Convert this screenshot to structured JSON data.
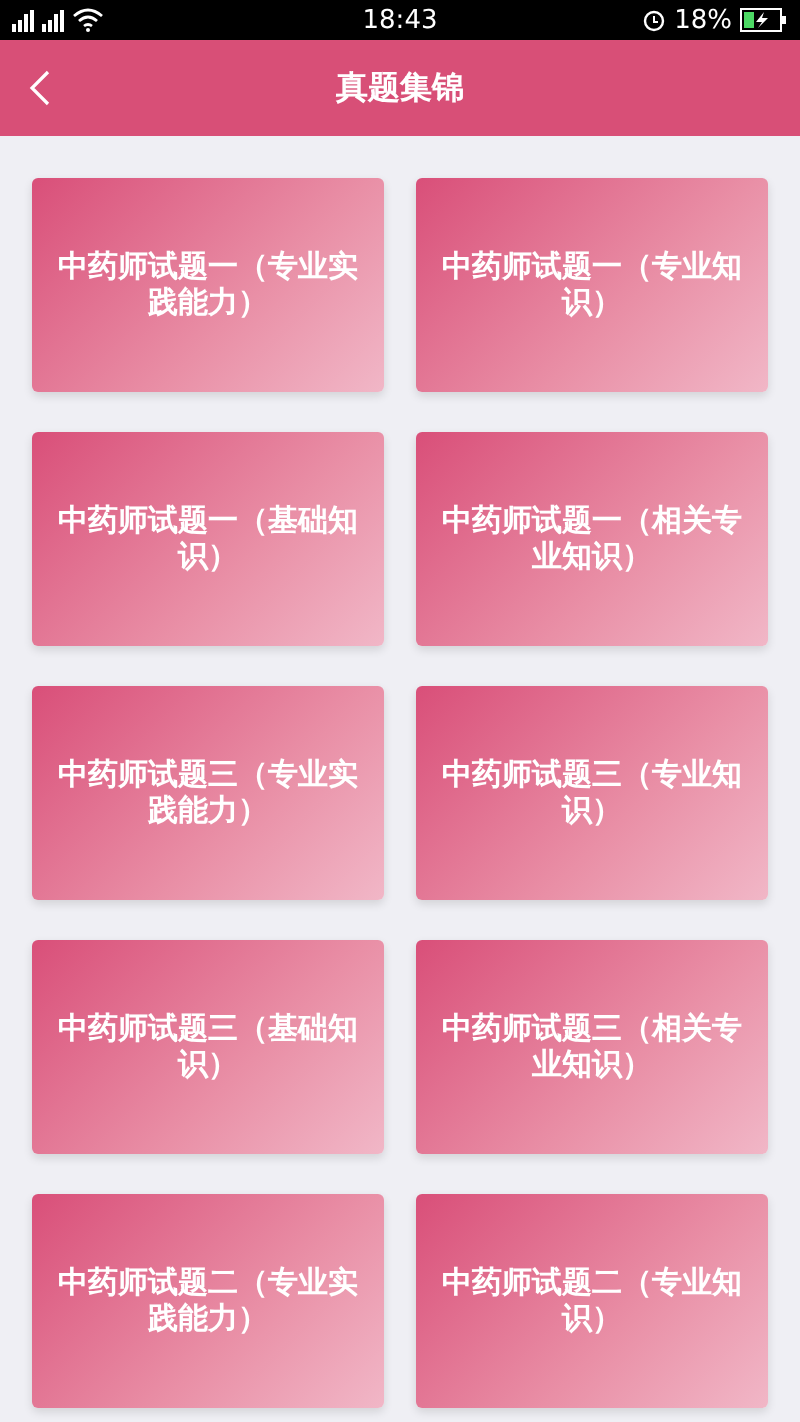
{
  "status_bar": {
    "time": "18:43",
    "battery": "18%"
  },
  "header": {
    "title": "真题集锦"
  },
  "cards": [
    {
      "title": "中药师试题一（专业实践能力）"
    },
    {
      "title": "中药师试题一（专业知识）"
    },
    {
      "title": "中药师试题一（基础知识）"
    },
    {
      "title": "中药师试题一（相关专业知识）"
    },
    {
      "title": "中药师试题三（专业实践能力）"
    },
    {
      "title": "中药师试题三（专业知识）"
    },
    {
      "title": "中药师试题三（基础知识）"
    },
    {
      "title": "中药师试题三（相关专业知识）"
    },
    {
      "title": "中药师试题二（专业实践能力）"
    },
    {
      "title": "中药师试题二（专业知识）"
    }
  ]
}
